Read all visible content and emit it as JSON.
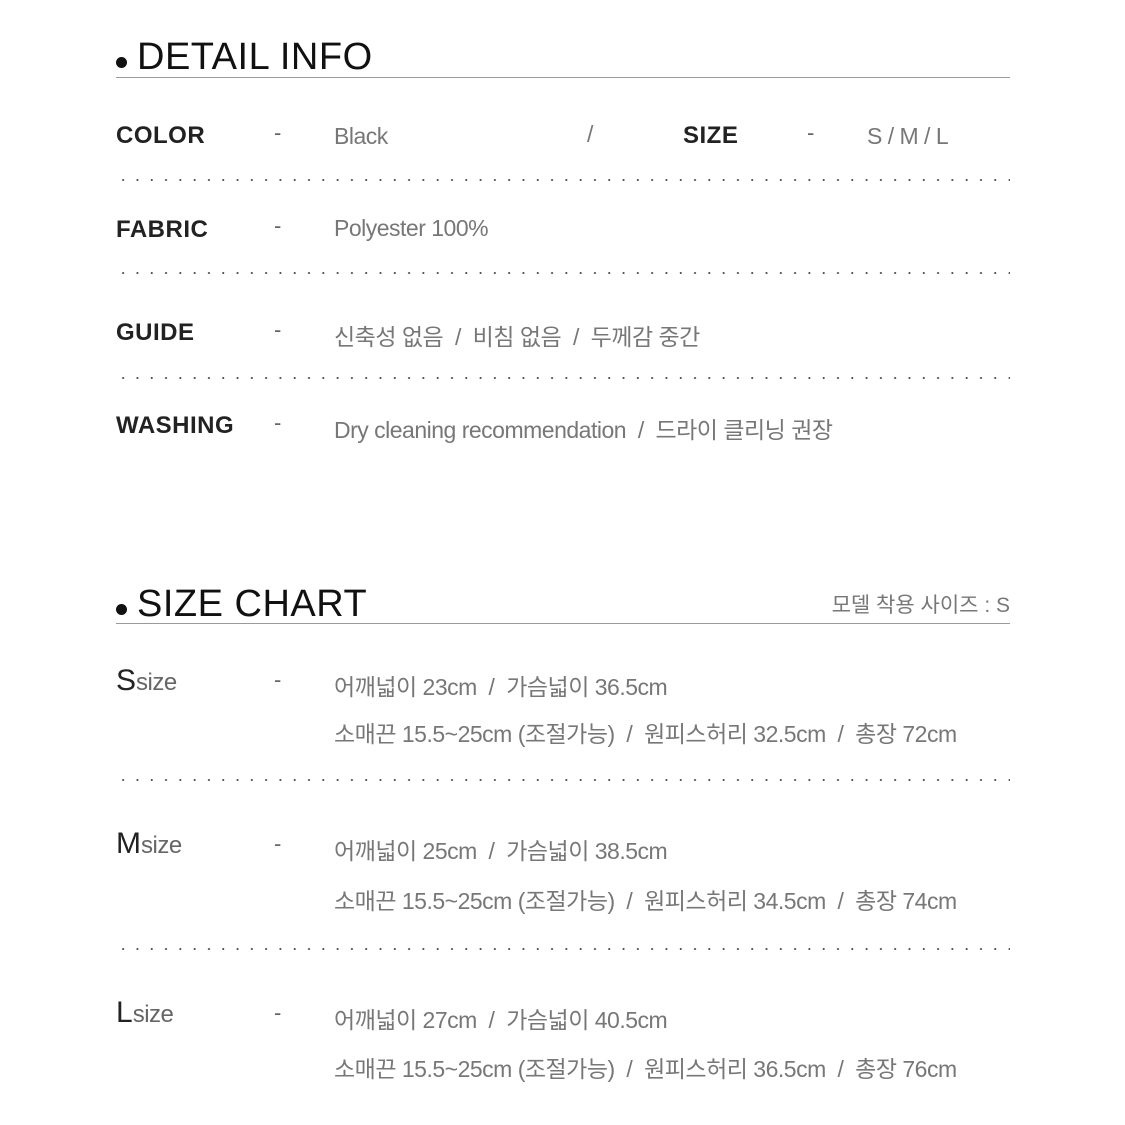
{
  "detail_info": {
    "title": "DETAIL INFO",
    "color": {
      "label": "COLOR",
      "dash": "-",
      "value": "Black"
    },
    "separator": "/",
    "size": {
      "label": "SIZE",
      "dash": "-",
      "value": "S / M / L"
    },
    "fabric": {
      "label": "FABRIC",
      "dash": "-",
      "value": "Polyester 100%"
    },
    "guide": {
      "label": "GUIDE",
      "dash": "-",
      "value": "신축성 없음  /  비침 없음  /  두께감 중간"
    },
    "washing": {
      "label": "WASHING",
      "dash": "-",
      "value": "Dry cleaning recommendation  /  드라이 클리닝 권장"
    }
  },
  "size_chart": {
    "title": "SIZE CHART",
    "model_note": "모델 착용 사이즈 : S",
    "sizes": [
      {
        "letter": "S",
        "suffix": "size",
        "dash": "-",
        "line1": "어깨넓이 23cm  /  가슴넓이 36.5cm",
        "line2": "소매끈 15.5~25cm (조절가능)  /  원피스허리 32.5cm  /  총장 72cm"
      },
      {
        "letter": "M",
        "suffix": "size",
        "dash": "-",
        "line1": "어깨넓이 25cm  /  가슴넓이 38.5cm",
        "line2": "소매끈 15.5~25cm (조절가능)  /  원피스허리 34.5cm  /  총장 74cm"
      },
      {
        "letter": "L",
        "suffix": "size",
        "dash": "-",
        "line1": "어깨넓이 27cm  /  가슴넓이 40.5cm",
        "line2": "소매끈 15.5~25cm (조절가능)  /  원피스허리 36.5cm  /  총장 76cm"
      }
    ]
  }
}
